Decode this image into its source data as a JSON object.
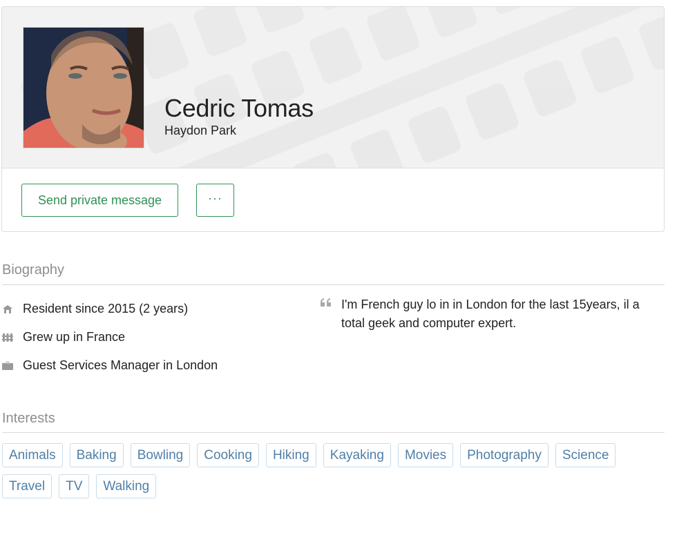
{
  "profile": {
    "name": "Cedric Tomas",
    "location": "Haydon Park",
    "avatar_alt": "Profile photo of Cedric Tomas"
  },
  "actions": {
    "message_label": "Send private message",
    "more_label": "···"
  },
  "biography": {
    "title": "Biography",
    "items": [
      {
        "icon": "home-icon",
        "text": "Resident since 2015 (2 years)"
      },
      {
        "icon": "fence-icon",
        "text": "Grew up in France"
      },
      {
        "icon": "briefcase-icon",
        "text": "Guest Services Manager in London"
      }
    ],
    "quote_icon": "quote-icon",
    "quote": "I'm French guy lo in in London for the last 15years, il a total geek and computer expert."
  },
  "interests": {
    "title": "Interests",
    "tags": [
      "Animals",
      "Baking",
      "Bowling",
      "Cooking",
      "Hiking",
      "Kayaking",
      "Movies",
      "Photography",
      "Science",
      "Travel",
      "TV",
      "Walking"
    ]
  },
  "colors": {
    "accent_green": "#2e9254",
    "tag_blue": "#4f7fa8",
    "tag_border": "#c9dcea",
    "muted_title": "#8e8e8e"
  }
}
